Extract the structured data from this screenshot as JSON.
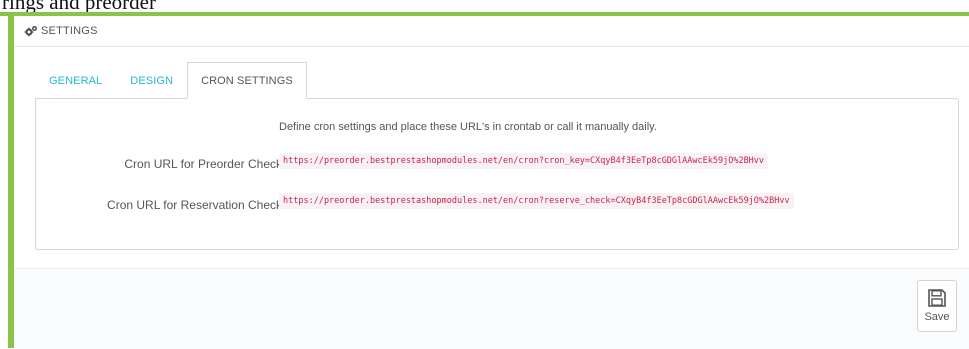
{
  "top_fragment": "rings and preorder",
  "panel": {
    "title": "SETTINGS"
  },
  "tabs": [
    {
      "label": "GENERAL",
      "active": false
    },
    {
      "label": "DESIGN",
      "active": false
    },
    {
      "label": "CRON SETTINGS",
      "active": true
    }
  ],
  "cron": {
    "intro": "Define cron settings and place these URL's in crontab or call it manually daily.",
    "rows": [
      {
        "label": "Cron URL for Preorder Check",
        "url": "https://preorder.bestprestashopmodules.net/en/cron?cron_key=CXqyB4f3EeTp8cGDGlAAwcEk59jO%2BHvv"
      },
      {
        "label": "Cron URL for Reservation Check",
        "url": "https://preorder.bestprestashopmodules.net/en/cron?reserve_check=CXqyB4f3EeTp8cGDGlAAwcEk59jO%2BHvv"
      }
    ]
  },
  "footer": {
    "save_label": "Save"
  },
  "icons": {
    "panel": "gears-icon",
    "save": "floppy-disk-icon"
  },
  "colors": {
    "accent_green": "#8bc34a",
    "tab_link": "#25b9d7",
    "code_text": "#c7254e",
    "code_bg": "#f9f2f4"
  }
}
